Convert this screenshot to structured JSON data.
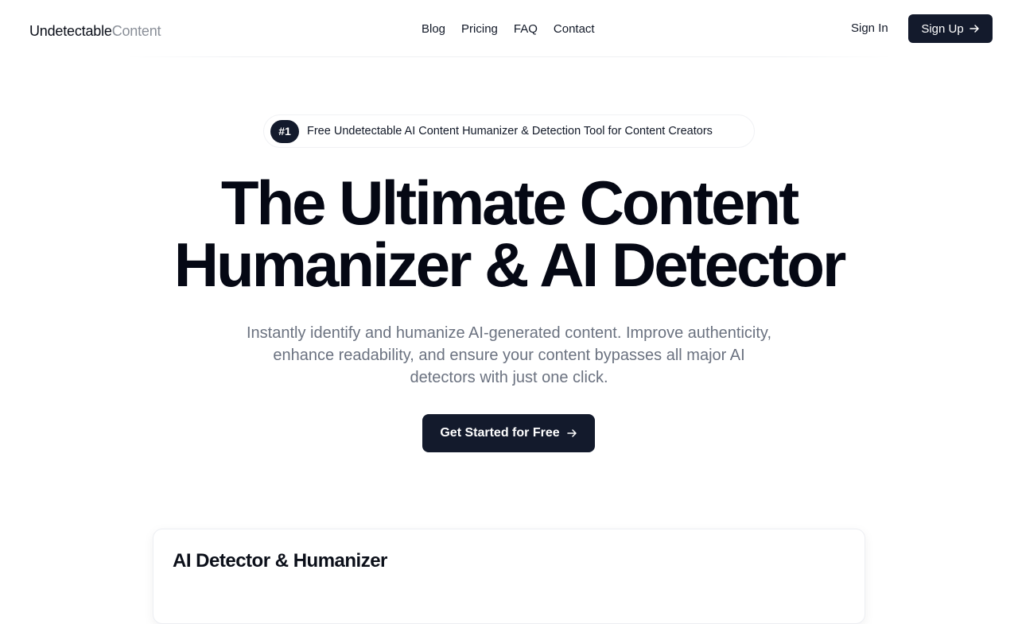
{
  "header": {
    "logo_part1": "Undetectable",
    "logo_part2": "Content",
    "nav": [
      "Blog",
      "Pricing",
      "FAQ",
      "Contact"
    ],
    "sign_in": "Sign In",
    "sign_up": "Sign Up"
  },
  "hero": {
    "badge_rank": "#1",
    "badge_text": "Free Undetectable AI Content Humanizer & Detection Tool for Content Creators",
    "title_line1": "The Ultimate Content",
    "title_line2": "Humanizer & AI Detector",
    "subtitle": "Instantly identify and humanize AI-generated content. Improve authenticity, enhance readability, and ensure your content bypasses all major AI detectors with just one click.",
    "cta": "Get Started for Free"
  },
  "card": {
    "title": "AI Detector & Humanizer"
  },
  "icons": {
    "signup_arrow": "arrow-right-icon",
    "cta_arrow": "arrow-right-icon"
  },
  "colors": {
    "primary": "#131a2c",
    "muted_text": "#6b7280",
    "logo_muted": "#8a8f98"
  }
}
